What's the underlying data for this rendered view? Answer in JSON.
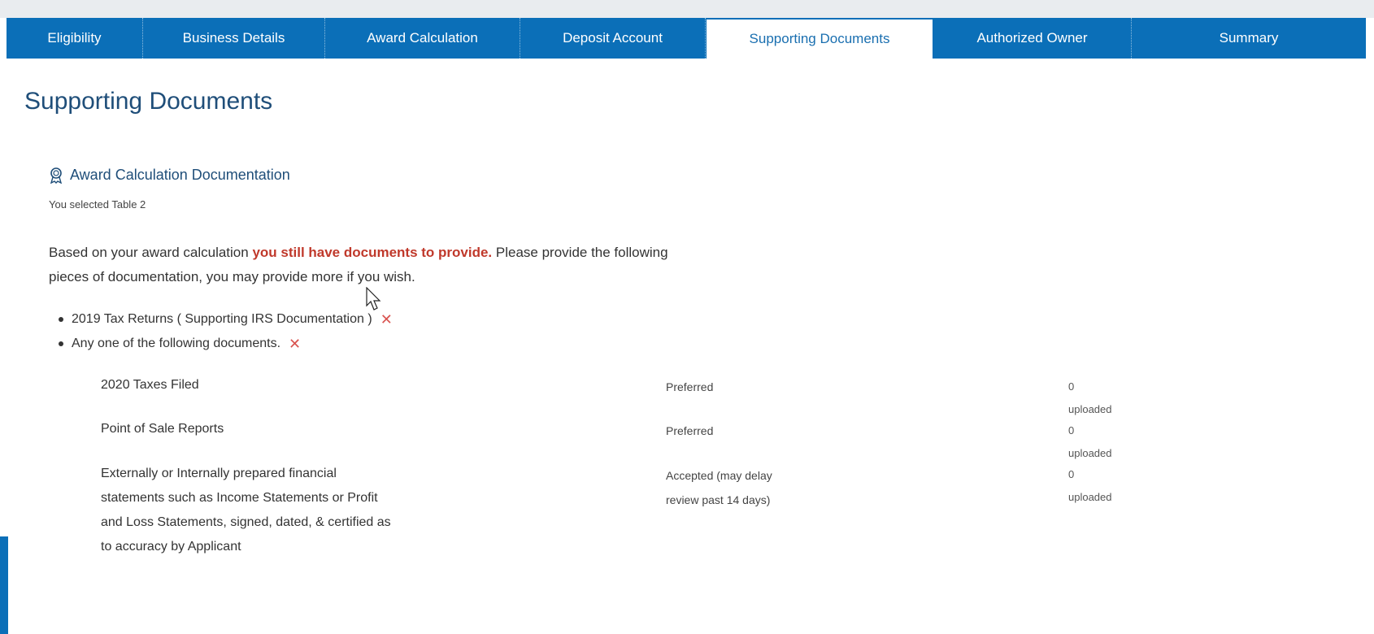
{
  "tabs": [
    {
      "label": "Eligibility",
      "active": false
    },
    {
      "label": "Business Details",
      "active": false
    },
    {
      "label": "Award Calculation",
      "active": false
    },
    {
      "label": "Deposit Account",
      "active": false
    },
    {
      "label": "Supporting Documents",
      "active": true
    },
    {
      "label": "Authorized Owner",
      "active": false
    },
    {
      "label": "Summary",
      "active": false
    }
  ],
  "page_title": "Supporting Documents",
  "section": {
    "icon": "award-ribbon-icon",
    "title": "Award Calculation Documentation",
    "selected": "You selected Table 2"
  },
  "intro": {
    "part1": "Based on your award calculation ",
    "highlight": "you still have documents to provide.",
    "part2": " Please provide the following pieces of documentation, you may provide more if you wish."
  },
  "requirements": [
    {
      "label": "2019 Tax Returns ( Supporting IRS Documentation )",
      "status_icon": "x-icon"
    },
    {
      "label": "Any one of the following documents.",
      "status_icon": "x-icon"
    }
  ],
  "documents": [
    {
      "name": "2020 Taxes Filed",
      "status": "Preferred",
      "count": "0 uploaded"
    },
    {
      "name": "Point of Sale Reports",
      "status": "Preferred",
      "count": "0 uploaded"
    },
    {
      "name": "Externally or Internally prepared financial statements such as Income Statements or Profit and Loss Statements, signed, dated, & certified as to accuracy by Applicant",
      "status": "Accepted (may delay review past 14 days)",
      "count": "0 uploaded"
    }
  ],
  "colors": {
    "tab_bar": "#0b6fb8",
    "title": "#1f4e79",
    "alert": "#c0392b",
    "x_mark": "#d9534f"
  }
}
